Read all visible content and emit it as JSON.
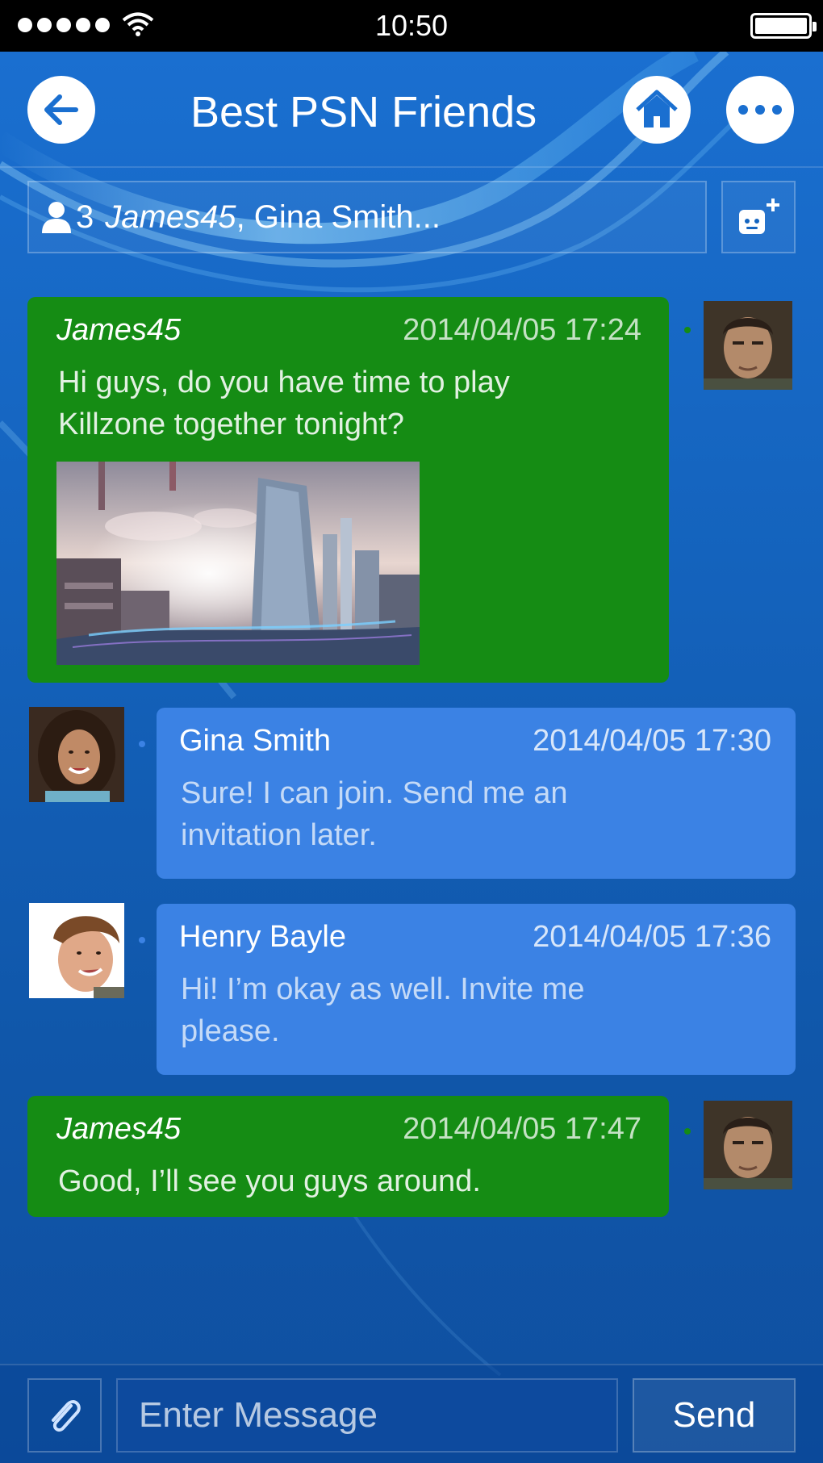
{
  "status_bar": {
    "time": "10:50"
  },
  "header": {
    "title": "Best PSN Friends"
  },
  "participants": {
    "count": "3",
    "first_name": "James45",
    "rest": ", Gina Smith..."
  },
  "messages": [
    {
      "sender": "James45",
      "timestamp": "2014/04/05 17:24",
      "text": "Hi guys, do you have time to play Killzone together tonight?",
      "has_image": true,
      "own": true
    },
    {
      "sender": "Gina Smith",
      "timestamp": "2014/04/05 17:30",
      "text": "Sure! I can join. Send me an invitation later.",
      "own": false
    },
    {
      "sender": "Henry Bayle",
      "timestamp": "2014/04/05 17:36",
      "text": "Hi! I’m okay as well. Invite me please.",
      "own": false
    },
    {
      "sender": "James45",
      "timestamp": "2014/04/05 17:47",
      "text": "Good, I’ll see you guys around.",
      "own": true
    }
  ],
  "composer": {
    "placeholder": "Enter Message",
    "send_label": "Send"
  },
  "colors": {
    "own_bubble": "#158c14",
    "other_bubble": "#3b82e4",
    "background": "#1565c0"
  }
}
